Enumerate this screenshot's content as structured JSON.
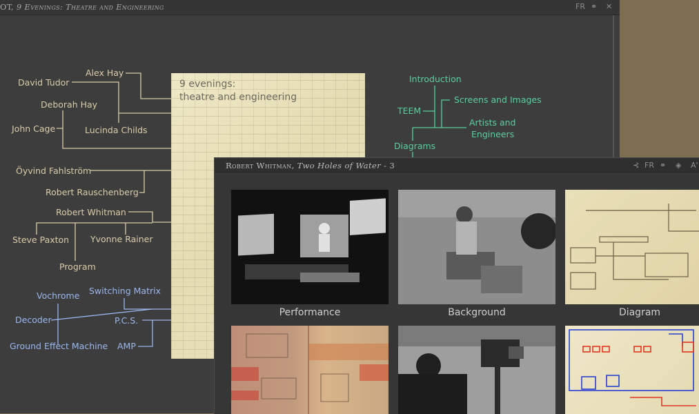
{
  "window1": {
    "title_prefix": "OT, ",
    "title_italic": "9 Evenings: Theatre and Engineering",
    "controls": {
      "lang": "FR",
      "link": "⚭",
      "close": "✕"
    }
  },
  "poster": {
    "line1": "9 evenings:",
    "line2": "theatre and engineering"
  },
  "people": {
    "alex_hay": "Alex Hay",
    "david_tudor": "David Tudor",
    "deborah_hay": "Deborah Hay",
    "john_cage": "John Cage",
    "lucinda_childs": "Lucinda Childs",
    "oyvind_fahlstrom": "Öyvind Fahlström",
    "robert_rauschenberg": "Robert Rauschenberg",
    "robert_whitman": "Robert Whitman",
    "steve_paxton": "Steve Paxton",
    "yvonne_rainer": "Yvonne Rainer",
    "program": "Program"
  },
  "technology": {
    "vochrome": "Vochrome",
    "switching_matrix": "Switching Matrix",
    "decoder": "Decoder",
    "pcs": "P.C.S.",
    "ground_effect_machine": "Ground Effect Machine",
    "amp": "AMP"
  },
  "sections": {
    "introduction": "Introduction",
    "teem": "TEEM",
    "screens_and_images": "Screens and Images",
    "artists_and_engineers_1": "Artists and",
    "artists_and_engineers_2": "Engineers",
    "diagrams": "Diagrams"
  },
  "window2": {
    "title_prefix": "Robert Whitman, ",
    "title_italic": "Two Holes of Water",
    "title_suffix": " - 3",
    "controls": {
      "share": "⊰",
      "lang": "FR",
      "link": "⚭",
      "layers": "◈",
      "text": "A'"
    }
  },
  "gallery": [
    {
      "caption": "Performance"
    },
    {
      "caption": "Background"
    },
    {
      "caption": "Diagram"
    },
    {
      "caption": ""
    },
    {
      "caption": ""
    },
    {
      "caption": ""
    }
  ],
  "colors": {
    "tan": "#dacca8",
    "blue": "#9ab8ef",
    "green": "#5bcf9e"
  }
}
